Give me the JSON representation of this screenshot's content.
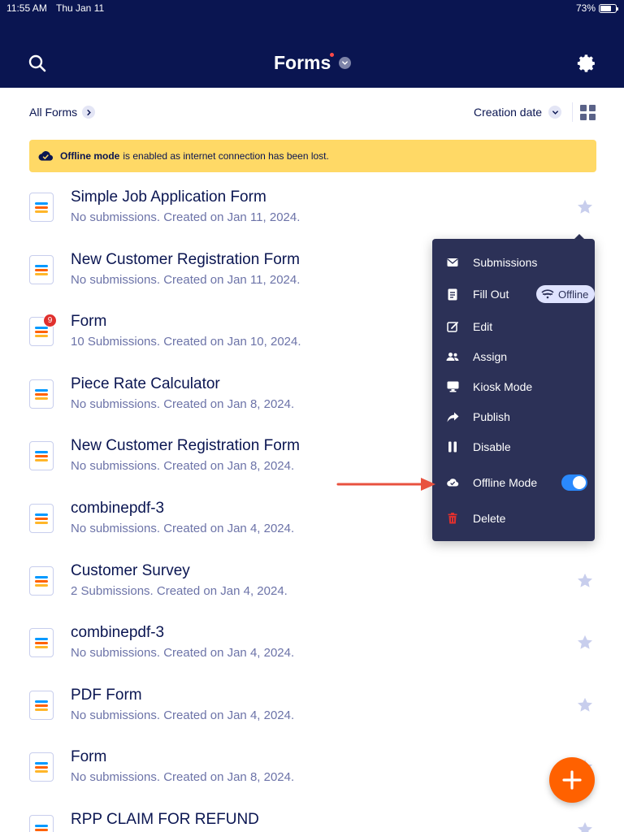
{
  "status_bar": {
    "time": "11:55 AM",
    "date": "Thu Jan 11",
    "battery": "73%",
    "battery_level": 0.73
  },
  "header": {
    "title": "Forms",
    "accent": "#0a1551",
    "notification_dot_color": "#ff4948"
  },
  "toolbar": {
    "filter_label": "All Forms",
    "sort_label": "Creation date"
  },
  "banner": {
    "bold": "Offline mode",
    "text": "is enabled as internet connection has been lost."
  },
  "forms": [
    {
      "title": "Simple Job Application Form",
      "subtitle": "No submissions. Created on Jan 11, 2024."
    },
    {
      "title": "New Customer Registration Form",
      "subtitle": "No submissions. Created on Jan 11, 2024."
    },
    {
      "title": "Form",
      "subtitle": "10 Submissions. Created on Jan 10, 2024.",
      "badge": "9"
    },
    {
      "title": "Piece Rate Calculator",
      "subtitle": "No submissions. Created on Jan 8, 2024."
    },
    {
      "title": "New Customer Registration Form",
      "subtitle": "No submissions. Created on Jan 8, 2024."
    },
    {
      "title": "combinepdf-3",
      "subtitle": "No submissions. Created on Jan 4, 2024."
    },
    {
      "title": "Customer Survey",
      "subtitle": "2 Submissions. Created on Jan 4, 2024."
    },
    {
      "title": "combinepdf-3",
      "subtitle": "No submissions. Created on Jan 4, 2024."
    },
    {
      "title": "PDF Form",
      "subtitle": "No submissions. Created on Jan 4, 2024."
    },
    {
      "title": "Form",
      "subtitle": "No submissions. Created on Jan 8, 2024."
    },
    {
      "title": "RPP CLAIM FOR REFUND",
      "subtitle": ""
    }
  ],
  "menu": {
    "items": [
      {
        "label": "Submissions",
        "icon": "envelope-icon"
      },
      {
        "label": "Fill Out",
        "icon": "document-icon"
      },
      {
        "label": "Edit",
        "icon": "edit-icon"
      },
      {
        "label": "Assign",
        "icon": "users-icon"
      },
      {
        "label": "Kiosk Mode",
        "icon": "monitor-icon"
      },
      {
        "label": "Publish",
        "icon": "share-arrow-icon"
      },
      {
        "label": "Disable",
        "icon": "pause-icon"
      },
      {
        "label": "Offline Mode",
        "icon": "cloud-check-icon"
      },
      {
        "label": "Delete",
        "icon": "trash-icon"
      }
    ],
    "offline_pill": "Offline",
    "offline_toggle_on": true,
    "toggle_color": "#2a89fd",
    "delete_color": "#e0302e"
  },
  "fab": {
    "label": "+",
    "color": "#ff6100"
  }
}
